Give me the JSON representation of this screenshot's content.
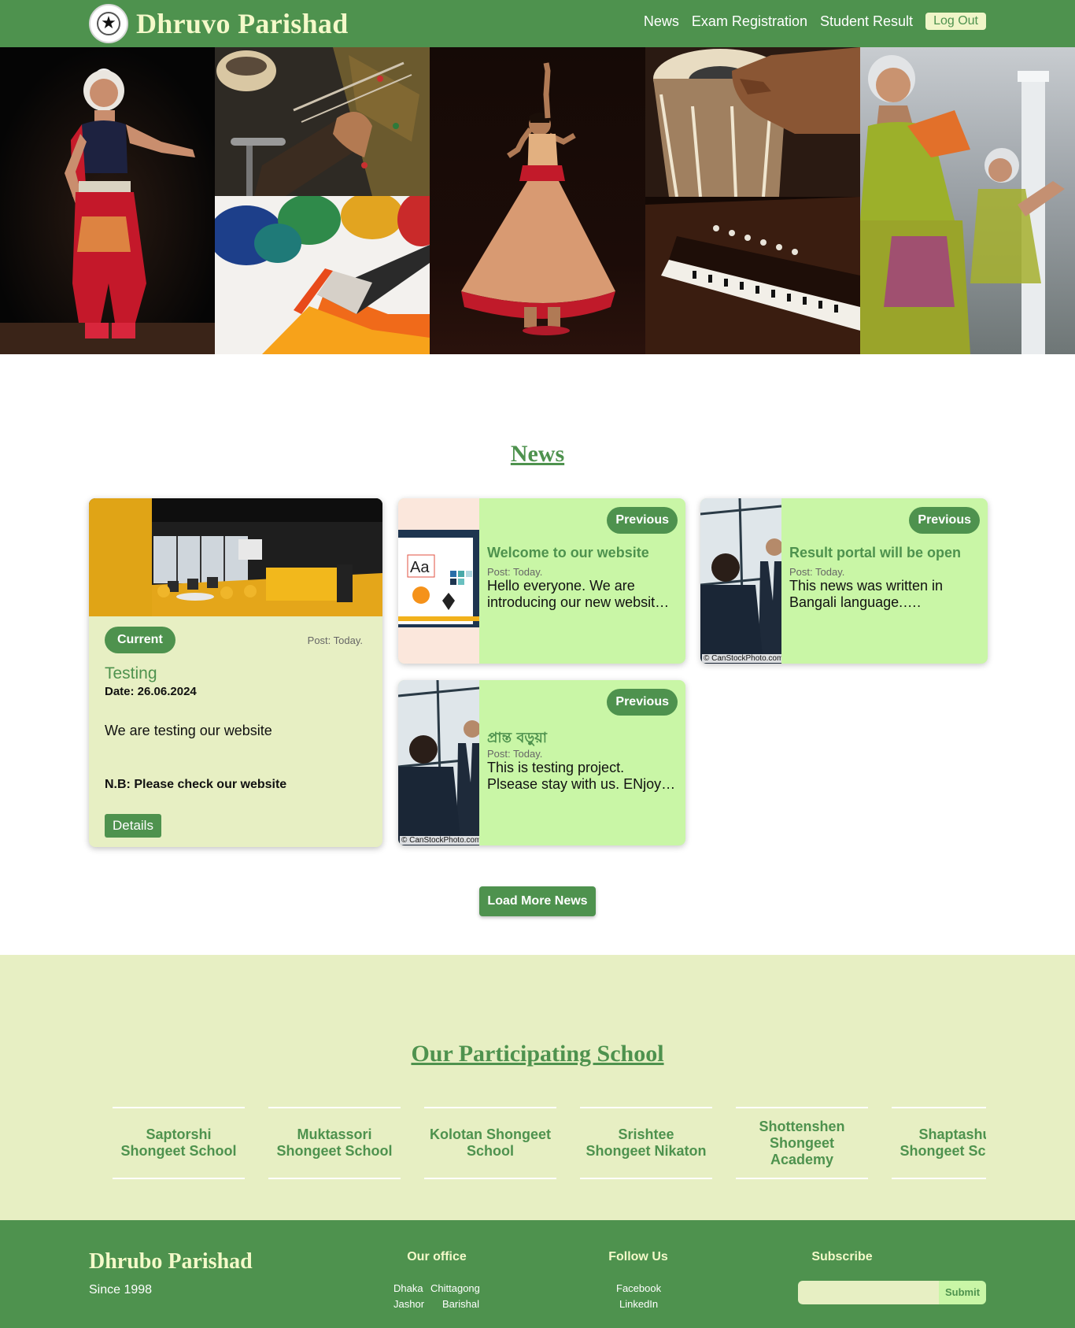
{
  "navbar": {
    "brand": "Dhruvo Parishad",
    "links": [
      "News",
      "Exam Registration",
      "Student Result"
    ],
    "logout": "Log Out"
  },
  "news": {
    "heading": "News",
    "featured": {
      "badge": "Current",
      "post": "Post: Today.",
      "title": "Testing",
      "date": "Date: 26.06.2024",
      "body": "We are testing our website",
      "nb": "N.B: Please check our website",
      "button": "Details"
    },
    "items": [
      {
        "badge": "Previous",
        "title": "Welcome to our website",
        "post": "Post: Today.",
        "body": "Hello everyone. We are introducing our new websit…"
      },
      {
        "badge": "Previous",
        "title": "Result portal will be open",
        "post": "Post: Today.",
        "body": "This news was written in Bangali language.….",
        "credit": "© CanStockPhoto.com"
      },
      {
        "badge": "Previous",
        "title": "প্রান্ত বড়ুয়া",
        "post": "Post: Today.",
        "body": "This is testing project. Plsease stay with us. ENjoy…",
        "credit": "© CanStockPhoto.com"
      }
    ],
    "load_more": "Load More News"
  },
  "schools": {
    "heading": "Our Participating School",
    "list": [
      "Saptorshi Shongeet School",
      "Muktassori Shongeet School",
      "Kolotan Shongeet School",
      "Srishtee Shongeet Nikaton",
      "Shottenshen Shongeet Academy",
      "Shaptashur Shongeet School"
    ]
  },
  "footer": {
    "brand": "Dhrubo Parishad",
    "since": "Since 1998",
    "office_heading": "Our office",
    "offices": [
      "Dhaka",
      "Chittagong",
      "Jashor",
      "Barishal"
    ],
    "follow_heading": "Follow Us",
    "social": [
      "Facebook",
      "LinkedIn"
    ],
    "subscribe_heading": "Subscribe",
    "submit": "Submit"
  },
  "colors": {
    "primary_green": "#4e924e",
    "cream": "#e7efc3",
    "light_green": "#c9f6a6",
    "brand_text": "#f4f9c9"
  }
}
